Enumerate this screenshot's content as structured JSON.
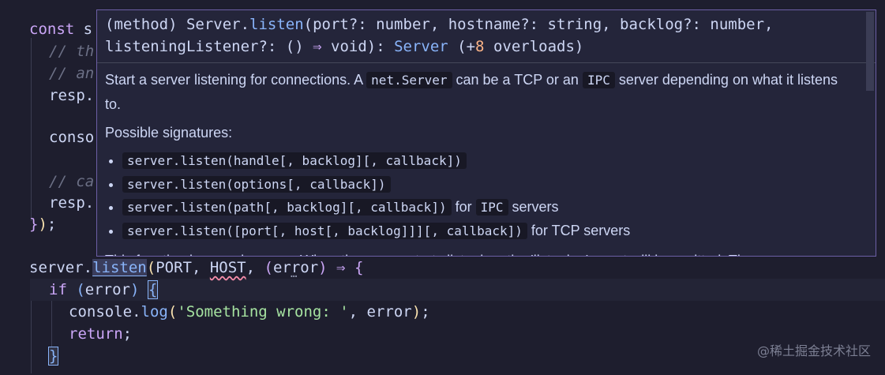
{
  "code": {
    "l1": {
      "kw": "const",
      "rest": " s"
    },
    "l2": "// th",
    "l3": "// an",
    "l4": "resp.",
    "l6": "conso",
    "l8": "// ca",
    "l9": "resp.",
    "l10": {
      "close_brace": "}",
      "close_paren": ")",
      "semi": ";"
    },
    "l12": {
      "obj": "server",
      "dot": ".",
      "method": "listen",
      "open": "(",
      "arg1": "PORT",
      "comma1": ", ",
      "arg2": "HOST",
      "comma2": ", ",
      "p_open": "(",
      "param": "error",
      "p_close": ")",
      "arrow": " ⇒ ",
      "brace": "{",
      "ellipsis": "…"
    },
    "l13": {
      "kw": "if",
      "sp": " ",
      "open": "(",
      "cond": "error",
      "close": ")",
      "brace": "{"
    },
    "l14": {
      "obj": "console",
      "dot": ".",
      "method": "log",
      "open": "(",
      "str": "'Something wrong: '",
      "comma": ", ",
      "arg": "error",
      "close": ")",
      "semi": ";"
    },
    "l15": {
      "kw": "return",
      "semi": ";"
    },
    "l16": "}"
  },
  "hover": {
    "sig_line1": {
      "a": "(method) Server.",
      "m": "listen",
      "b": "(port?: number, hostname?: string, backlog?: number,"
    },
    "sig_line2": {
      "a": "listeningListener?: () ",
      "arrow": "⇒",
      "b": " void): ",
      "ret": "Server",
      "c": " (+",
      "n": "8",
      "d": " overloads)"
    },
    "desc": {
      "a": "Start a server listening for connections. A ",
      "chip1": "net.Server",
      "b": " can be a TCP or an ",
      "chip2": "IPC",
      "c": " server depending on what it listens to."
    },
    "possible": "Possible signatures:",
    "items": [
      {
        "code": "server.listen(handle[, backlog][, callback])",
        "suffix": "",
        "chip": "",
        "suffix2": ""
      },
      {
        "code": "server.listen(options[, callback])",
        "suffix": "",
        "chip": "",
        "suffix2": ""
      },
      {
        "code": "server.listen(path[, backlog][, callback])",
        "suffix": " for ",
        "chip": "IPC",
        "suffix2": " servers"
      },
      {
        "code": "server.listen([port[, host[, backlog]]][, callback])",
        "suffix": " for TCP servers",
        "chip": "",
        "suffix2": ""
      }
    ],
    "cut": "This function is asynchronous. When the server starts listening, the 'listening' event will be emitted. The"
  },
  "watermark": "@稀土掘金技术社区"
}
